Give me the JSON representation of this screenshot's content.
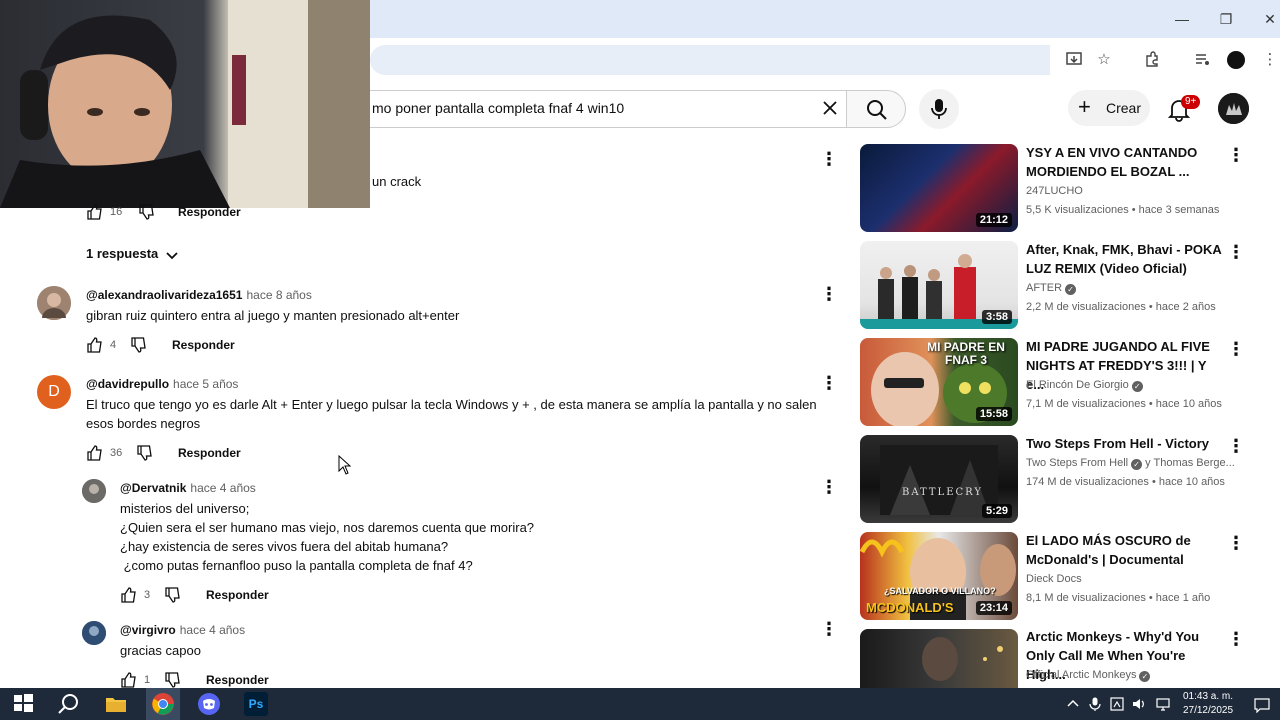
{
  "browser": {
    "window_controls": {
      "minimize": "—",
      "restore": "❐",
      "close": "✕"
    }
  },
  "masthead": {
    "search_value": "mo poner pantalla completa fnaf 4 win10",
    "create_label": "Crear",
    "notif_count": "9+"
  },
  "comments": {
    "top_fragment": "un crack",
    "top_like_count": "16",
    "reply_label": "Responder",
    "replies_toggle": "1 respuesta",
    "items": [
      {
        "handle": "@alexandraolivarideza1651",
        "time": "hace 8 años",
        "text": "gibran ruiz quintero entra al juego y manten presionado alt+enter",
        "likes": "4"
      },
      {
        "handle": "@davidrepullo",
        "time": "hace 5 años",
        "text_line1": "El truco que tengo yo es darle Alt + Enter y luego pulsar la tecla Windows y + , de esta manera se amplía la pantalla y no salen",
        "text_line2": "esos bordes negros",
        "likes": "36",
        "avatar_letter": "D"
      }
    ],
    "replies": [
      {
        "handle": "@Dervatnik",
        "time": "hace 4 años",
        "lines": [
          "misterios del universo;",
          "¿Quien sera el ser humano mas viejo, nos daremos cuenta que morira?",
          "¿hay existencia de seres vivos fuera del abitab humana?",
          " ¿como putas fernanfloo puso la pantalla completa de fnaf 4?"
        ],
        "likes": "3"
      },
      {
        "handle": "@virgivro",
        "time": "hace 4 años",
        "text": "gracias capoo",
        "likes": "1"
      }
    ]
  },
  "sidebar": {
    "videos": [
      {
        "title": "YSY A EN VIVO CANTANDO MORDIENDO EL BOZAL ...",
        "channel": "247LUCHO",
        "meta": "5,5 K visualizaciones • hace 3 semanas",
        "duration": "21:12"
      },
      {
        "title": "After, Knak, FMK, Bhavi - POKA LUZ REMIX (Video Oficial)",
        "channel": "AFTER",
        "meta": "2,2 M de visualizaciones • hace 2 años",
        "duration": "3:58"
      },
      {
        "title": "MI PADRE JUGANDO AL FIVE NIGHTS AT FREDDY'S 3!!! | Y e...",
        "channel": "El Rincón De Giorgio",
        "meta": "7,1 M de visualizaciones • hace 10 años",
        "duration": "15:58",
        "thumb_text": "MI PADRE EN FNAF 3"
      },
      {
        "title": "Two Steps From Hell - Victory",
        "channel": "Two Steps From Hell",
        "channel_suffix": "y Thomas Berge...",
        "meta": "174 M de visualizaciones • hace 10 años",
        "duration": "5:29",
        "thumb_text": "BATTLECRY"
      },
      {
        "title": "El LADO MÁS OSCURO de McDonald's | Documental",
        "channel": "Dieck Docs",
        "meta": "8,1 M de visualizaciones • hace 1 año",
        "duration": "23:14",
        "thumb_text": "MCDONALD'S",
        "thumb_text2": "¿SALVADOR O VILLANO?"
      },
      {
        "title": "Arctic Monkeys - Why'd You Only Call Me When You're High...",
        "channel": "Official Arctic Monkeys",
        "meta": "",
        "duration": ""
      }
    ]
  },
  "taskbar": {
    "time": "01:43 a. m.",
    "date": "27/12/2025",
    "ps_label": "Ps"
  },
  "colors": {
    "accent_red": "#cc0000",
    "taskbar": "#1e2a3a",
    "titlebar": "#dfe9f8"
  }
}
